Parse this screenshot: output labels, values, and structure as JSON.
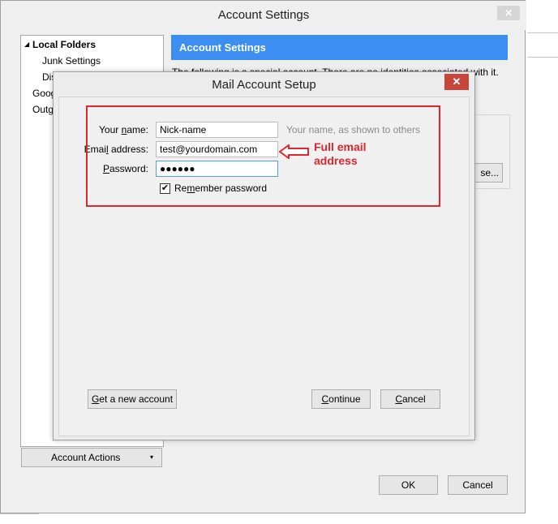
{
  "outer_window": {
    "title": "Account Settings",
    "close_glyph": "✕",
    "tree": {
      "items": [
        {
          "label": "Local Folders",
          "expander": "◢"
        },
        {
          "label": "Junk Settings"
        },
        {
          "label": "Dis"
        },
        {
          "label": "Goog"
        },
        {
          "label": "Outg"
        }
      ]
    },
    "account_actions": {
      "label": "Account Actions",
      "caret": "▾"
    },
    "header": "Account Settings",
    "description": "The following is a special account. There are no identities associated with it.",
    "browse_label": "se...",
    "ok_label": "OK",
    "cancel_label": "Cancel"
  },
  "dialog": {
    "title": "Mail Account Setup",
    "close_glyph": "✕",
    "fields": {
      "name": {
        "label_pre": "Your ",
        "label_u": "n",
        "label_post": "ame:",
        "value": "Nick-name",
        "hint": "Your name, as shown to others"
      },
      "email": {
        "label_pre": "Emai",
        "label_u": "l",
        "label_post": " address:",
        "value": "test@yourdomain.com"
      },
      "password": {
        "label_pre": "",
        "label_u": "P",
        "label_post": "assword:",
        "value": "●●●●●●"
      }
    },
    "remember": {
      "pre": "Re",
      "u": "m",
      "post": "ember password",
      "checked_glyph": "✔"
    },
    "buttons": {
      "new_account": {
        "pre": "",
        "u": "G",
        "post": "et a new account"
      },
      "continue": {
        "pre": "",
        "u": "C",
        "post": "ontinue"
      },
      "cancel": {
        "pre": "",
        "u": "C",
        "post": "ancel"
      }
    }
  },
  "annotation": {
    "text": "Full email\naddress",
    "color": "#e0262f"
  }
}
